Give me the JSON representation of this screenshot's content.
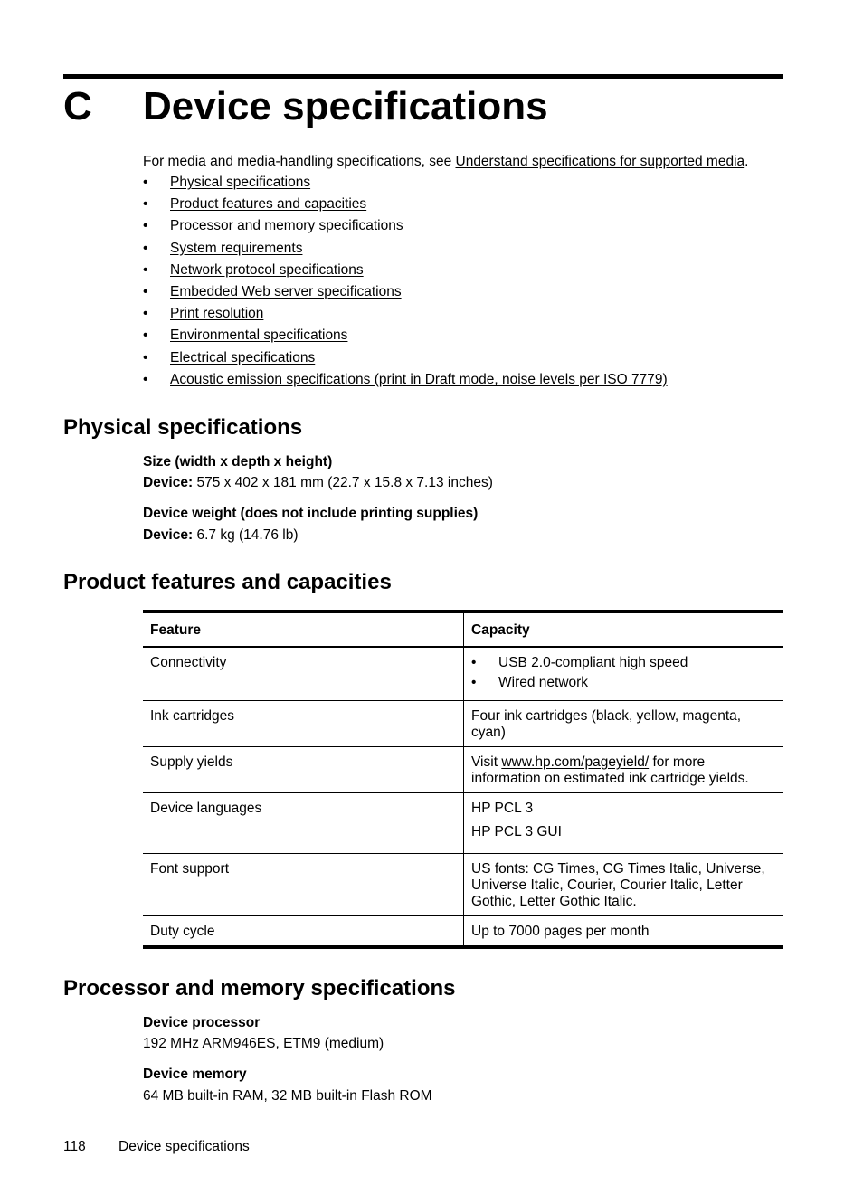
{
  "chapter": {
    "letter": "C",
    "title": "Device specifications"
  },
  "intro": {
    "text": "For media and media-handling specifications, see ",
    "link": "Understand specifications for supported media",
    "suffix": "."
  },
  "toc": [
    "Physical specifications",
    "Product features and capacities",
    "Processor and memory specifications",
    "System requirements",
    "Network protocol specifications",
    "Embedded Web server specifications",
    "Print resolution",
    "Environmental specifications",
    "Electrical specifications",
    "Acoustic emission specifications (print in Draft mode, noise levels per ISO 7779)"
  ],
  "physical": {
    "heading": "Physical specifications",
    "size_label": "Size (width x depth x height)",
    "size_prefix": "Device:",
    "size_value": " 575 x 402 x 181 mm (22.7 x 15.8 x 7.13 inches)",
    "weight_label": "Device weight (does not include printing supplies)",
    "weight_prefix": "Device:",
    "weight_value": " 6.7 kg (14.76 lb)"
  },
  "features": {
    "heading": "Product features and capacities",
    "columns": [
      "Feature",
      "Capacity"
    ],
    "rows": [
      {
        "feature": "Connectivity",
        "bullets": [
          "USB 2.0-compliant high speed",
          "Wired network"
        ]
      },
      {
        "feature": "Ink cartridges",
        "capacity": "Four ink cartridges (black, yellow, magenta, cyan)"
      },
      {
        "feature": "Supply yields",
        "pre": "Visit ",
        "link": "www.hp.com/pageyield/",
        "post": " for more information on estimated ink cartridge yields."
      },
      {
        "feature": "Device languages",
        "lines": [
          "HP PCL 3",
          "HP PCL 3 GUI"
        ]
      },
      {
        "feature": "Font support",
        "capacity": "US fonts: CG Times, CG Times Italic, Universe, Universe Italic, Courier, Courier Italic, Letter Gothic, Letter Gothic Italic."
      },
      {
        "feature": "Duty cycle",
        "capacity": "Up to 7000 pages per month"
      }
    ]
  },
  "processor": {
    "heading": "Processor and memory specifications",
    "proc_label": "Device processor",
    "proc_value": "192 MHz ARM946ES, ETM9 (medium)",
    "mem_label": "Device memory",
    "mem_value": "64 MB built-in RAM, 32 MB built-in Flash ROM"
  },
  "footer": {
    "page": "118",
    "title": "Device specifications"
  },
  "bullet_glyph": "•"
}
